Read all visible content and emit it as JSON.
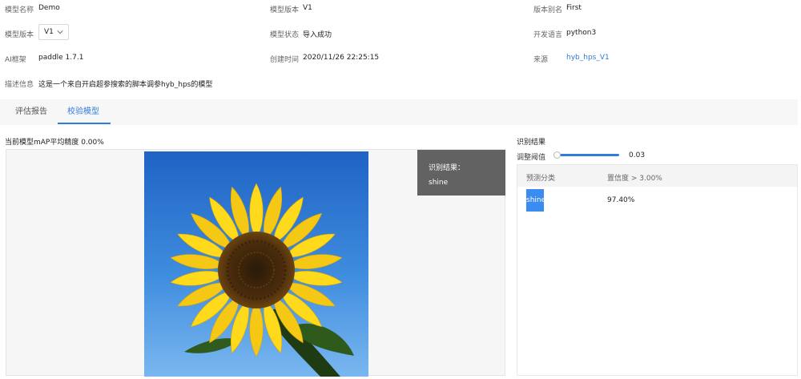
{
  "meta": {
    "model_name_label": "模型名称",
    "model_name_value": "Demo",
    "model_version_label": "模型版本",
    "model_version_value": "V1",
    "version_alias_label": "版本别名",
    "version_alias_value": "First",
    "model_version_select_label": "模型版本",
    "model_version_select_value": "V1",
    "model_status_label": "模型状态",
    "model_status_value": "导入成功",
    "dev_language_label": "开发语言",
    "dev_language_value": "python3",
    "ai_framework_label": "AI框架",
    "ai_framework_value": "paddle 1.7.1",
    "created_time_label": "创建时间",
    "created_time_value": "2020/11/26 22:25:15",
    "source_label": "来源",
    "source_value": "hyb_hps_V1",
    "description_label": "描述信息",
    "description_value": "这是一个来自开启超参搜索的脚本调参hyb_hps的模型"
  },
  "tabs": [
    {
      "label": "评估报告",
      "active": false
    },
    {
      "label": "校验模型",
      "active": true
    }
  ],
  "viewer": {
    "accuracy_text": "当前模型mAP平均精度 0.00%",
    "overlay_title": "识别结果：",
    "overlay_value": "shine"
  },
  "results": {
    "title": "识别结果",
    "threshold_label": "调整阈值",
    "threshold_value": "0.03",
    "threshold_fraction": 0.03,
    "col_class": "预测分类",
    "col_confidence": "置信度 > 3.00%",
    "rows": [
      {
        "class": "shine",
        "confidence": "97.40%"
      }
    ]
  },
  "colors": {
    "accent": "#2f7cdb",
    "highlight": "#3a8cf0",
    "overlay_bg": "#626262"
  }
}
